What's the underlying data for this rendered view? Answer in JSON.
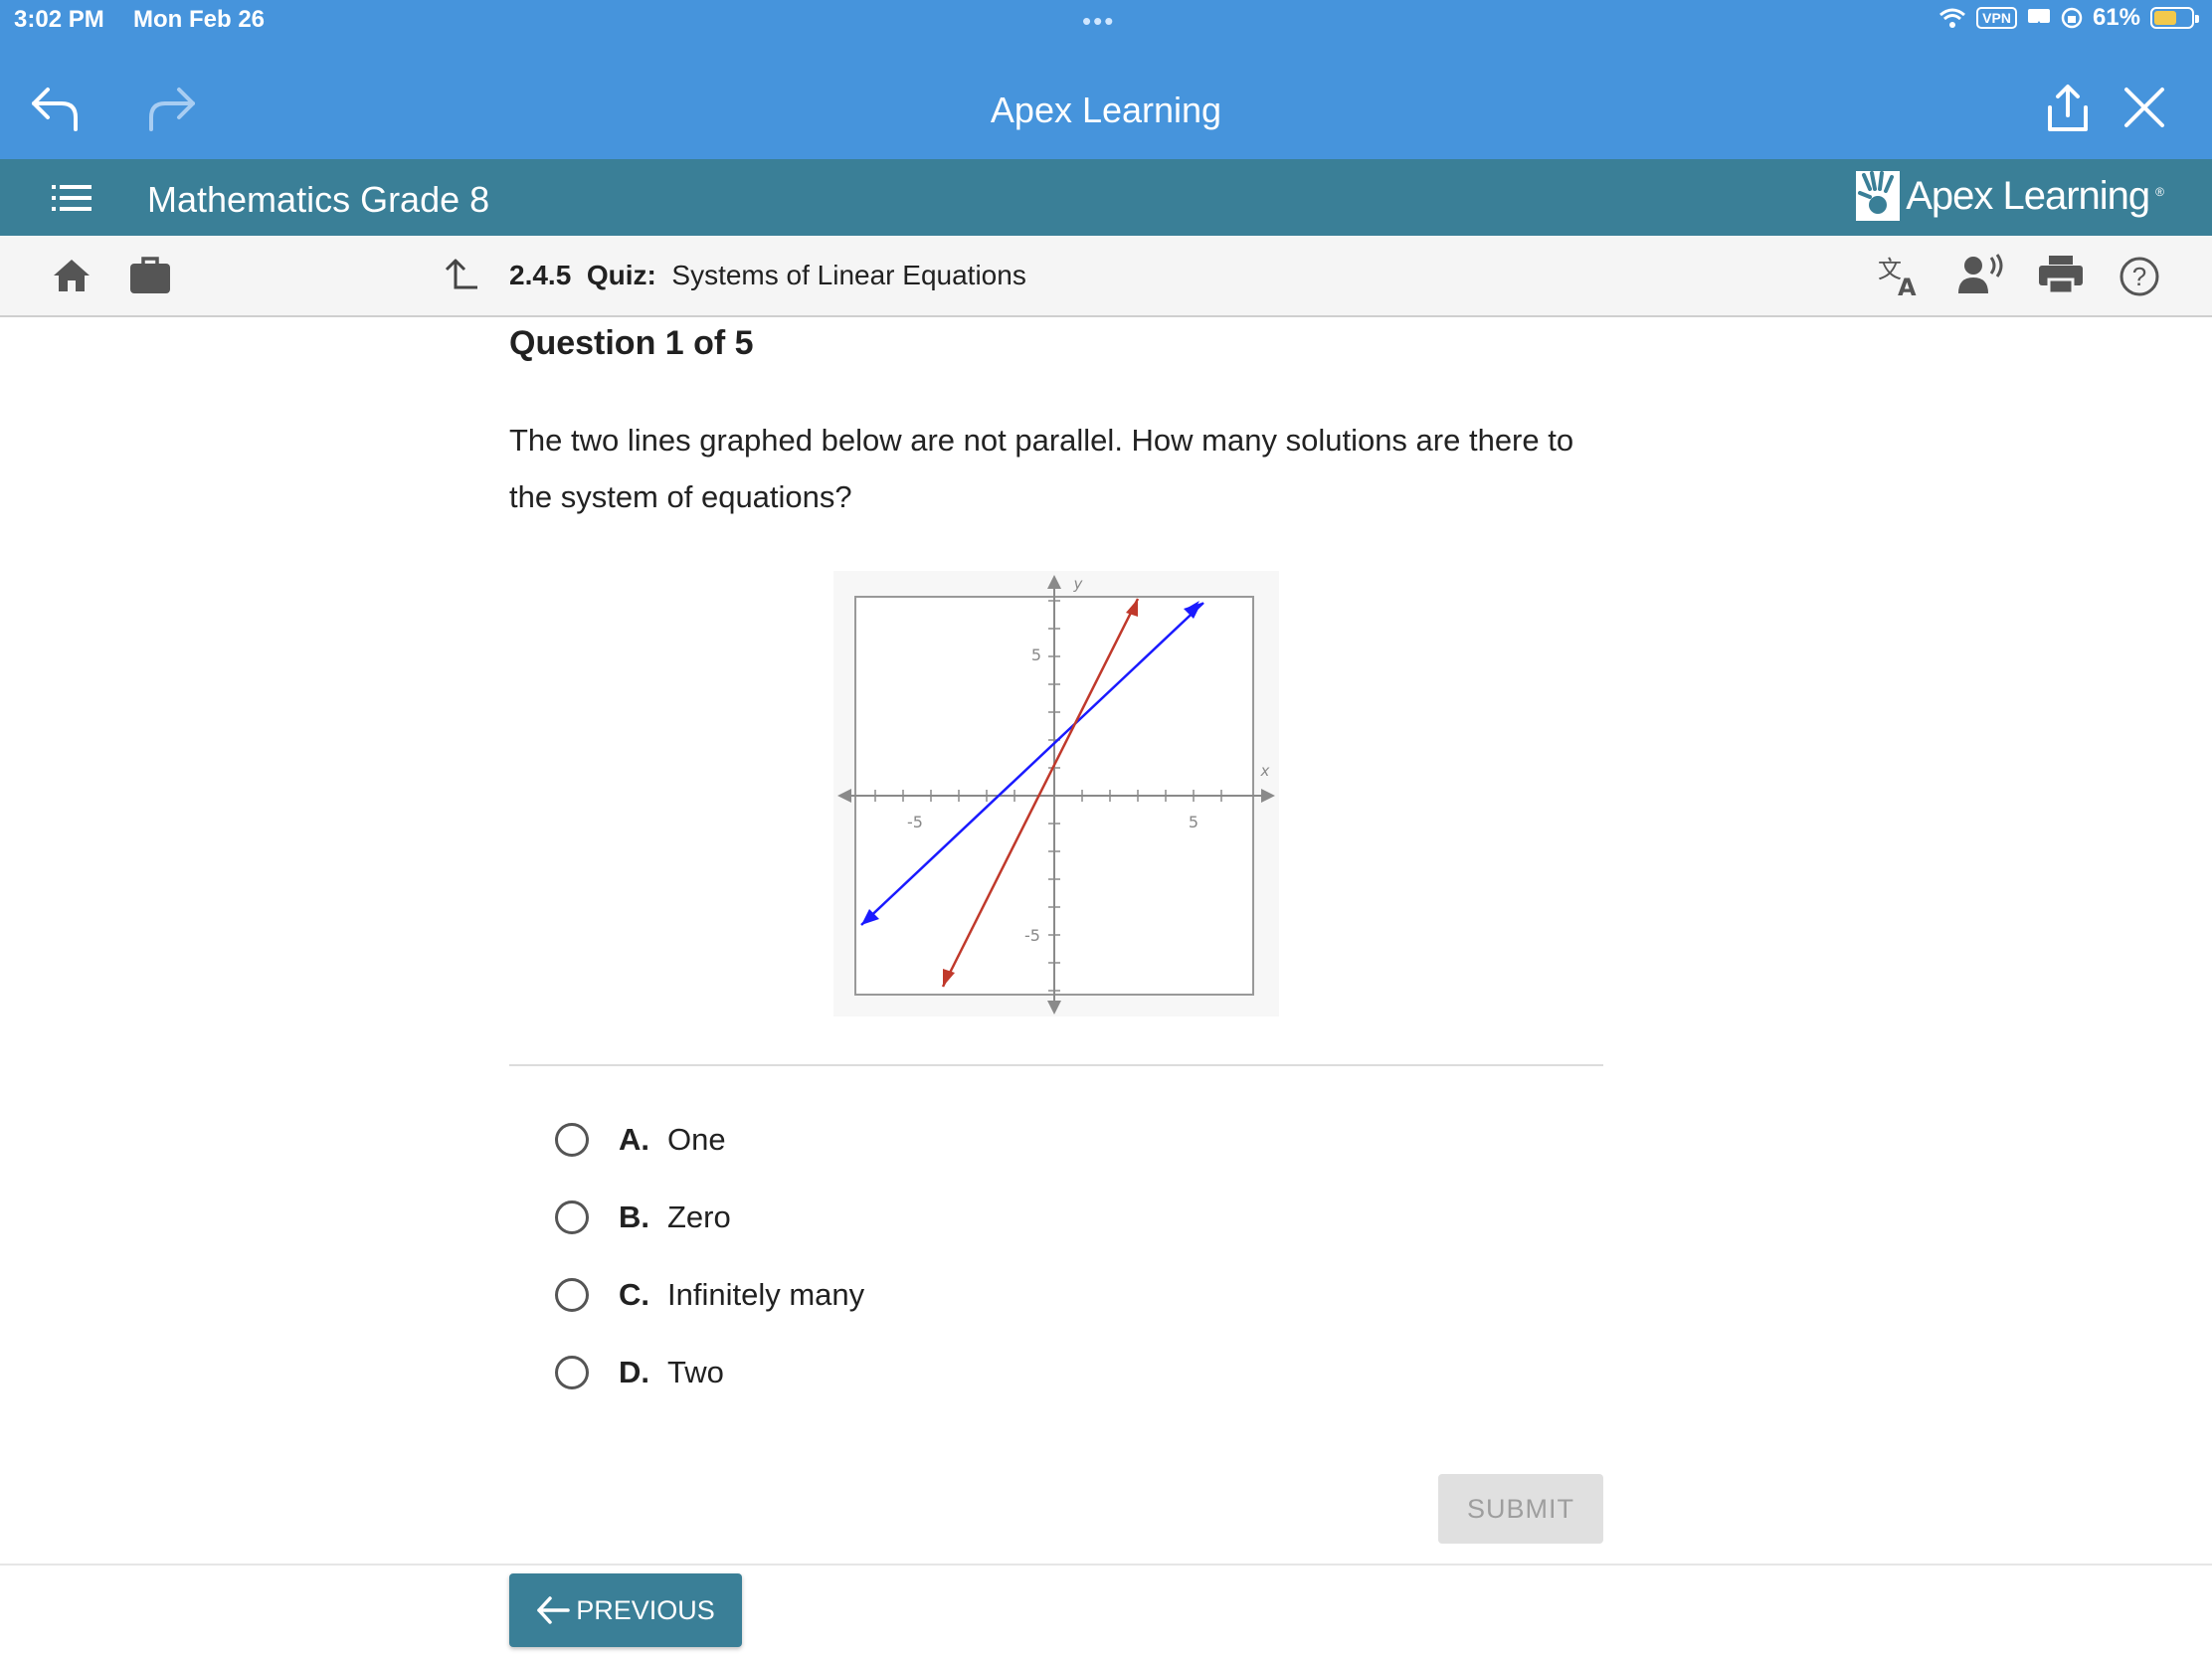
{
  "status": {
    "time": "3:02 PM",
    "date": "Mon Feb 26",
    "vpn": "VPN",
    "battery": "61%",
    "battery_level": 0.61
  },
  "browser": {
    "title": "Apex Learning"
  },
  "course": {
    "title": "Mathematics Grade 8",
    "brand": "Apex Learning",
    "brand_mark": "®"
  },
  "breadcrumb": {
    "number": "2.4.5",
    "type": "Quiz:",
    "name": "Systems of Linear Equations"
  },
  "question": {
    "header": "Question 1 of 5",
    "text": "The two lines graphed below are not parallel. How many solutions are there to the system of equations?"
  },
  "graph": {
    "x_axis_label": "x",
    "y_axis_label": "y",
    "x_ticks": [
      "-5",
      "5"
    ],
    "y_ticks": [
      "5",
      "-5"
    ],
    "colors": {
      "line1": "#1a1aff",
      "line2": "#c0392b",
      "axis": "#8a8a8a"
    }
  },
  "choices": [
    {
      "letter": "A.",
      "text": "One"
    },
    {
      "letter": "B.",
      "text": "Zero"
    },
    {
      "letter": "C.",
      "text": "Infinitely many"
    },
    {
      "letter": "D.",
      "text": "Two"
    }
  ],
  "buttons": {
    "submit": "SUBMIT",
    "previous": "PREVIOUS"
  },
  "colors": {
    "browser_bar": "#4694dc",
    "course_bar": "#3a7f97",
    "toolbar": "#f5f5f5"
  }
}
